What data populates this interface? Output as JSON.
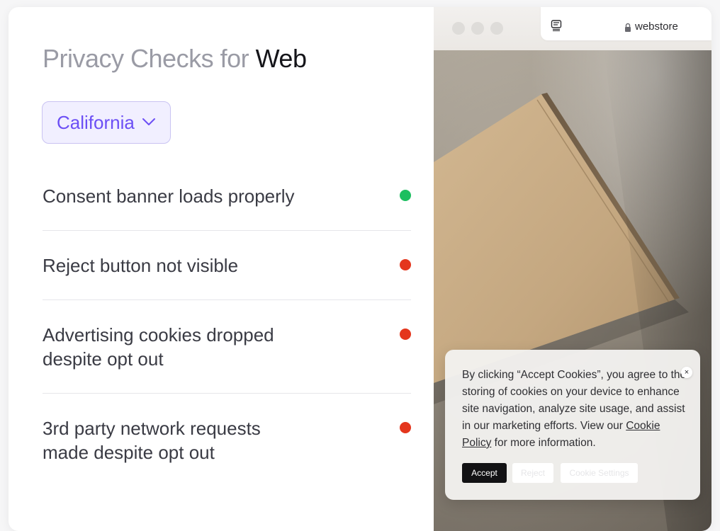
{
  "header": {
    "title_prefix": "Privacy Checks for",
    "title_accent": "Web"
  },
  "region": {
    "selected": "California"
  },
  "checks": [
    {
      "line1": "Consent banner loads properly",
      "line2": "",
      "status": "pass",
      "color": "#1dbf60"
    },
    {
      "line1": "Reject button not visible",
      "line2": "",
      "status": "fail",
      "color": "#e4361d"
    },
    {
      "line1": "Advertising cookies dropped",
      "line2": "despite opt out",
      "status": "fail",
      "color": "#e4361d"
    },
    {
      "line1": "3rd party network requests",
      "line2": "made despite opt out",
      "status": "fail",
      "color": "#e4361d"
    }
  ],
  "browser": {
    "url": "webstore",
    "icons": [
      "sidebar-icon",
      "lock-icon"
    ]
  },
  "cookie_banner": {
    "text_main": "By clicking “Accept Cookies”, you agree to the storing of cookies on your device to enhance site navigation, analyze site usage, and assist in our marketing efforts. View our",
    "link_text": "Cookie Policy",
    "text_end": "for more information.",
    "close_label": "×",
    "accept_label": "Accept",
    "reject_label": "Reject",
    "settings_label": "Cookie Settings"
  },
  "colors": {
    "accent_purple": "#6c4ff5",
    "pass_green": "#1dbf60",
    "fail_red": "#e4361d"
  }
}
